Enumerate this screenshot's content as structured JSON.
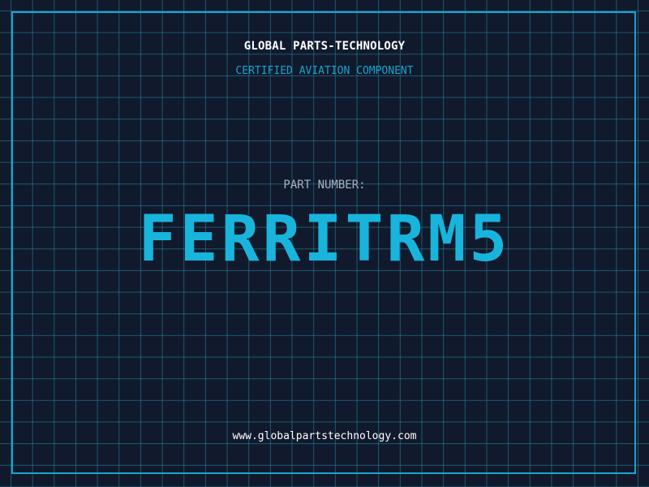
{
  "header": {
    "company": "GLOBAL PARTS-TECHNOLOGY",
    "tagline": "CERTIFIED AVIATION COMPONENT"
  },
  "part": {
    "label": "PART NUMBER:",
    "number": "FERRITRM5"
  },
  "footer": {
    "url": "www.globalpartstechnology.com"
  },
  "colors": {
    "background": "#101a2c",
    "accent": "#18b4dc",
    "grid": "#288caa"
  }
}
